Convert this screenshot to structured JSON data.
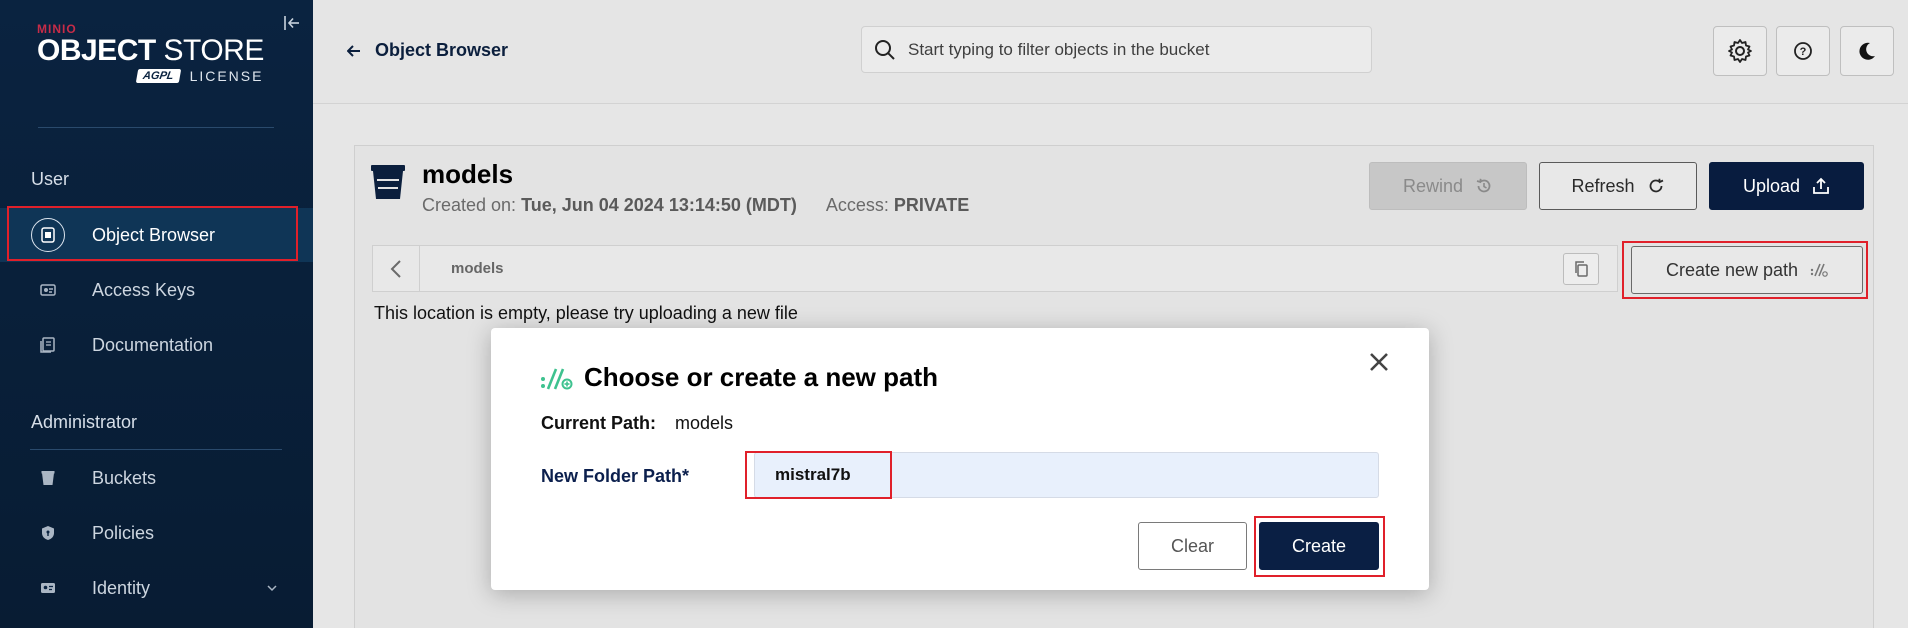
{
  "sidebar": {
    "logo": {
      "minio": "MINIO",
      "brand_bold": "OBJECT",
      "brand_light": " STORE",
      "agpl": "AGPL",
      "license": "LICENSE"
    },
    "user_section": "User",
    "user_items": [
      {
        "label": "Object Browser",
        "icon": "object-browser-icon",
        "active": true
      },
      {
        "label": "Access Keys",
        "icon": "access-keys-icon"
      },
      {
        "label": "Documentation",
        "icon": "documentation-icon"
      }
    ],
    "admin_section": "Administrator",
    "admin_items": [
      {
        "label": "Buckets",
        "icon": "buckets-icon"
      },
      {
        "label": "Policies",
        "icon": "policies-icon"
      },
      {
        "label": "Identity",
        "icon": "identity-icon"
      }
    ]
  },
  "header": {
    "back_label": "Object Browser",
    "search_placeholder": "Start typing to filter objects in the bucket",
    "tools": [
      "settings-icon",
      "help-icon",
      "dark-mode-icon"
    ]
  },
  "bucket": {
    "name": "models",
    "created_label": "Created on:",
    "created_value": "Tue, Jun 04 2024 13:14:50 (MDT)",
    "access_label": "Access:",
    "access_value": "PRIVATE"
  },
  "actions": {
    "rewind": "Rewind",
    "refresh": "Refresh",
    "upload": "Upload",
    "create_path": "Create new path"
  },
  "breadcrumb": {
    "path": "models"
  },
  "empty_message": "This location is empty, please try uploading a new file",
  "modal": {
    "title": "Choose or create a new path",
    "current_path_label": "Current Path:",
    "current_path_value": "models",
    "new_path_label": "New Folder Path*",
    "new_path_value": "mistral7b",
    "clear": "Clear",
    "create": "Create"
  },
  "colors": {
    "sidebar_bg": "#0a2340",
    "primary": "#081c3f",
    "highlight": "#e0202a",
    "accent_green": "#3ec28f"
  }
}
